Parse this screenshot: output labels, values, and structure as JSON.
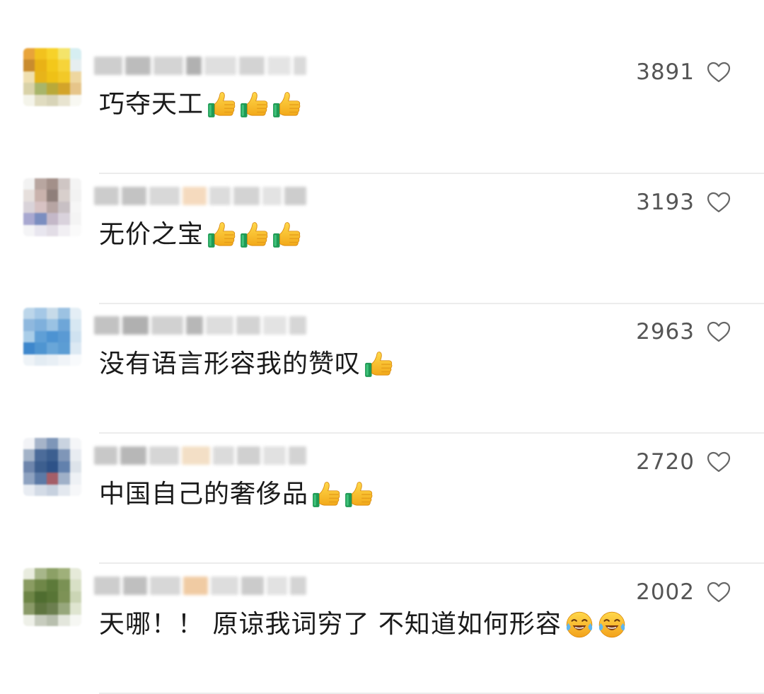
{
  "comments": [
    {
      "text": "巧夺天工",
      "emojis": [
        "thumbs-up",
        "thumbs-up",
        "thumbs-up"
      ],
      "likes": "3891",
      "avatar_colors": [
        "#e8a43a",
        "#f2c21e",
        "#f7d22a",
        "#f4e46a",
        "#d6eef2",
        "#c98c2e",
        "#e9b216",
        "#f3c81b",
        "#f6d43a",
        "#e6eef0",
        "#f0e0b0",
        "#e7b41a",
        "#efc117",
        "#f2c928",
        "#eed7a0",
        "#d9d2a8",
        "#a8b56a",
        "#b9a93a",
        "#d3a42a",
        "#e6c58a",
        "#f4f4ea",
        "#e0dcc0",
        "#d8d4b8",
        "#e8e4d0",
        "#f8f8f2"
      ],
      "name_colors": [
        "#c9c9c9",
        "#b5b5b5",
        "#d0d0d0",
        "#a9a9a9",
        "#dcdcdc",
        "#cfcfcf",
        "#e2e2e2",
        "#d6d6d6"
      ]
    },
    {
      "text": "无价之宝",
      "emojis": [
        "thumbs-up",
        "thumbs-up",
        "thumbs-up"
      ],
      "likes": "3193",
      "avatar_colors": [
        "#f2f2f2",
        "#b8a6a0",
        "#a39089",
        "#cfc6c4",
        "#f4f4f4",
        "#e6dfdc",
        "#c9b2ac",
        "#8f7f7a",
        "#d8cfcc",
        "#f2f2f2",
        "#d9d3d9",
        "#d7c2c3",
        "#b7a5a3",
        "#c8c0c4",
        "#f6f6f6",
        "#a8a8d0",
        "#7b8ec0",
        "#c4b8c8",
        "#d9d2dc",
        "#f4f4f4",
        "#f4f4f6",
        "#e8e6ef",
        "#e2dde6",
        "#f1eff3",
        "#fafafa"
      ],
      "name_colors": [
        "#c7c7c7",
        "#bdbdbd",
        "#d4d4d4",
        "#f4d7b8",
        "#d9d9d9",
        "#cfcfcf",
        "#e0e0e0",
        "#c8c8c8"
      ]
    },
    {
      "text": "没有语言形容我的赞叹",
      "emojis": [
        "thumbs-up"
      ],
      "likes": "2963",
      "avatar_colors": [
        "#bcd6ea",
        "#a5c8e6",
        "#c7dbe9",
        "#9cc2e2",
        "#e4eef5",
        "#8fb8de",
        "#7fb0dc",
        "#9ac2e3",
        "#6ea6d8",
        "#d7e7f2",
        "#a9cde8",
        "#5f9fd6",
        "#4d93d2",
        "#5a9ad4",
        "#cfe2f0",
        "#3e87cc",
        "#4f95d1",
        "#69a6d8",
        "#5c9dd4",
        "#dce9f3",
        "#eef3f7",
        "#e3ecf3",
        "#e8eff5",
        "#f0f4f8",
        "#f8fafc"
      ],
      "name_colors": [
        "#bcbcbc",
        "#a8a8a8",
        "#cdcdcd",
        "#b0b0b0",
        "#dadada",
        "#cfcfcf",
        "#e1e1e1",
        "#d2d2d2"
      ]
    },
    {
      "text": "中国自己的奢侈品",
      "emojis": [
        "thumbs-up",
        "thumbs-up"
      ],
      "likes": "2720",
      "avatar_colors": [
        "#f2f3f6",
        "#a6b4c9",
        "#7e96b8",
        "#c9d3e0",
        "#f5f6f8",
        "#a3b3c8",
        "#4c6c9a",
        "#3c5f90",
        "#7f96b8",
        "#e8ecf1",
        "#6e86ac",
        "#3d5f8f",
        "#2e5288",
        "#6281ad",
        "#dde3ea",
        "#8ea2c0",
        "#5c7aa6",
        "#a45e68",
        "#9fb0c8",
        "#eef1f5",
        "#e8ecf2",
        "#d3dbe6",
        "#c7d1df",
        "#e3e8ef",
        "#f6f7f9"
      ],
      "name_colors": [
        "#c3c3c3",
        "#b0b0b0",
        "#d2d2d2",
        "#f2dcc0",
        "#d8d8d8",
        "#cbcbcb",
        "#dedede",
        "#cfcfcf"
      ]
    },
    {
      "text": "天哪！！ 原谅我词穷了 不知道如何形容",
      "emojis": [
        "laugh-cry",
        "laugh-cry"
      ],
      "likes": "2002",
      "avatar_colors": [
        "#e9ecdf",
        "#a7b68a",
        "#8ca066",
        "#9fb07a",
        "#e6ead9",
        "#8a9c62",
        "#6f8748",
        "#5d7a3a",
        "#7a9154",
        "#d8e0c6",
        "#6d8546",
        "#4f6d30",
        "#587536",
        "#7d9256",
        "#cbd5b5",
        "#8a9a68",
        "#5f7540",
        "#6c7f4f",
        "#97a77c",
        "#dfe5d0",
        "#eef0e8",
        "#c7ccbe",
        "#b8bfae",
        "#e3e6dc",
        "#f6f7f3"
      ],
      "name_colors": [
        "#c8c8c8",
        "#b9b9b9",
        "#d3d3d3",
        "#efc69a",
        "#dadada",
        "#c6c6c6",
        "#dfdfdf",
        "#d0d0d0"
      ]
    }
  ]
}
